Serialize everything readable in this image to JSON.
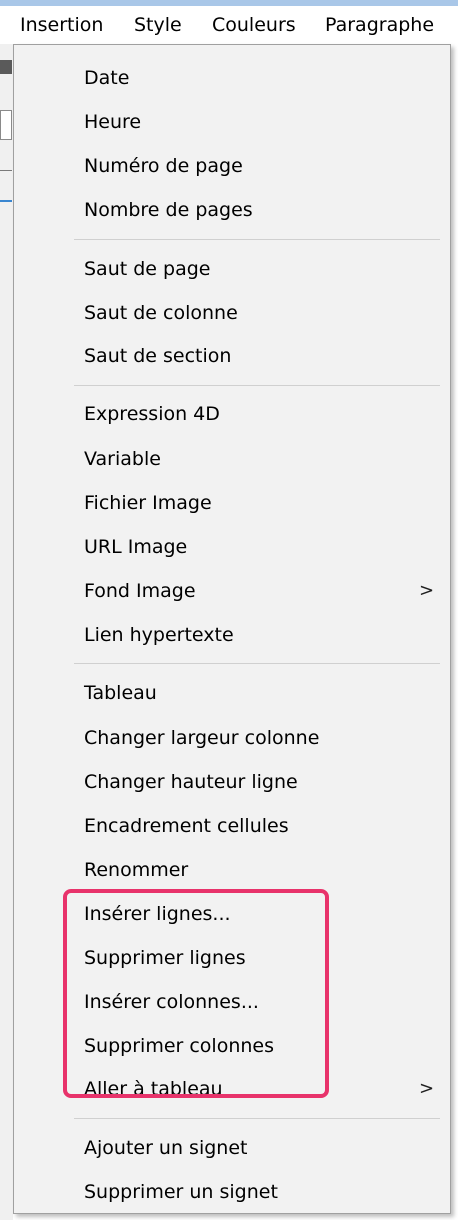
{
  "menubar": {
    "items": [
      "Insertion",
      "Style",
      "Couleurs",
      "Paragraphe"
    ]
  },
  "menu": {
    "items": [
      {
        "label": "Date",
        "has_submenu": false
      },
      {
        "label": "Heure",
        "has_submenu": false
      },
      {
        "label": "Numéro de page",
        "has_submenu": false
      },
      {
        "label": "Nombre de pages",
        "has_submenu": false
      },
      {
        "label": "Saut de page",
        "has_submenu": false
      },
      {
        "label": "Saut de colonne",
        "has_submenu": false
      },
      {
        "label": "Saut de section",
        "has_submenu": false
      },
      {
        "label": "Expression 4D",
        "has_submenu": false
      },
      {
        "label": "Variable",
        "has_submenu": false
      },
      {
        "label": "Fichier Image",
        "has_submenu": false
      },
      {
        "label": "URL Image",
        "has_submenu": false
      },
      {
        "label": "Fond Image",
        "has_submenu": true,
        "arrow": ">"
      },
      {
        "label": "Lien hypertexte",
        "has_submenu": false
      },
      {
        "label": "Tableau",
        "has_submenu": false
      },
      {
        "label": "Changer largeur colonne",
        "has_submenu": false
      },
      {
        "label": "Changer hauteur ligne",
        "has_submenu": false
      },
      {
        "label": "Encadrement cellules",
        "has_submenu": false
      },
      {
        "label": "Renommer",
        "has_submenu": false
      },
      {
        "label": "Insérer lignes...",
        "has_submenu": false
      },
      {
        "label": "Supprimer lignes",
        "has_submenu": false
      },
      {
        "label": "Insérer colonnes...",
        "has_submenu": false
      },
      {
        "label": "Supprimer colonnes",
        "has_submenu": false
      },
      {
        "label": "Aller à tableau",
        "has_submenu": true,
        "arrow": ">"
      },
      {
        "label": "Ajouter un signet",
        "has_submenu": false
      },
      {
        "label": "Supprimer un signet",
        "has_submenu": false
      }
    ]
  },
  "colors": {
    "highlight_border": "#e8336b",
    "menu_background": "#f2f2f2",
    "menubar_accent": "#a9c7e8"
  }
}
